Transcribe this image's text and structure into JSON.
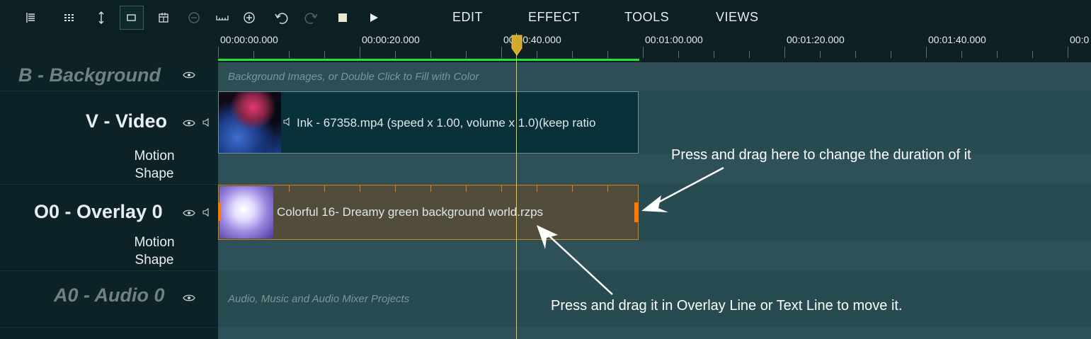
{
  "toolbar": {
    "tools": [
      {
        "name": "track-list-icon",
        "glyph": "☰"
      },
      {
        "name": "grid-icon",
        "glyph": "⋮⋮"
      },
      {
        "name": "vertical-resize-icon",
        "glyph": "↕"
      },
      {
        "name": "select-rect-icon",
        "glyph": "▭"
      },
      {
        "name": "calendar-icon",
        "glyph": "▦"
      },
      {
        "name": "zoom-out-icon",
        "glyph": "⊖"
      },
      {
        "name": "ruler-icon",
        "glyph": "⎵"
      },
      {
        "name": "zoom-in-icon",
        "glyph": "⊕"
      },
      {
        "name": "undo-icon",
        "glyph": "↶"
      },
      {
        "name": "redo-icon",
        "glyph": "↷"
      },
      {
        "name": "stop-icon",
        "glyph": "■"
      },
      {
        "name": "play-icon",
        "glyph": "▶"
      }
    ],
    "menus": [
      "EDIT",
      "EFFECT",
      "TOOLS",
      "VIEWS"
    ]
  },
  "ruler": {
    "labels": [
      "00:00:00.000",
      "00:00:20.000",
      "00:00:40.000",
      "00:01:00.000",
      "00:01:20.000",
      "00:01:40.000",
      "00:0"
    ]
  },
  "tracks": {
    "background": {
      "title": "B - Background",
      "hint": "Background Images, or Double Click to Fill with Color"
    },
    "video": {
      "title": "V - Video",
      "sub1": "Motion",
      "sub2": "Shape",
      "clip": "Ink - 67358.mp4  (speed x 1.00, volume x 1.0)(keep ratio"
    },
    "overlay": {
      "title": "O0 - Overlay 0",
      "sub1": "Motion",
      "sub2": "Shape",
      "clip": "Colorful 16- Dreamy green background world.rzps"
    },
    "audio": {
      "title": "A0 - Audio 0",
      "hint": "Audio, Music and Audio Mixer Projects"
    }
  },
  "annotations": {
    "duration": "Press and drag here to change the duration of it",
    "move": "Press and drag it in Overlay Line or Text Line to move it."
  },
  "colors": {
    "accent_green": "#1fe33a",
    "playhead": "#e7c93a",
    "overlay_border": "#d0831e",
    "handle": "#ff7a00"
  }
}
